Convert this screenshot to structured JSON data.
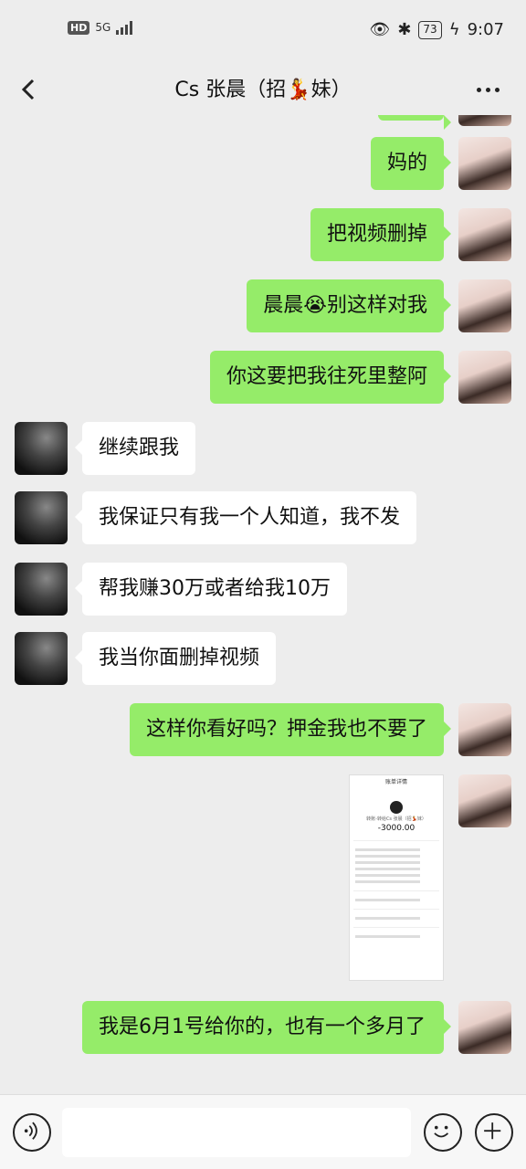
{
  "status": {
    "net": "5G",
    "hd": "HD",
    "battery": "73",
    "time": "9:07"
  },
  "nav": {
    "title": "Cs 张晨（招💃妹）"
  },
  "messages": [
    {
      "from": "me",
      "text": "妈的"
    },
    {
      "from": "me",
      "text": "把视频删掉"
    },
    {
      "from": "me",
      "text": "晨晨😭别这样对我"
    },
    {
      "from": "me",
      "text": "你这要把我往死里整阿"
    },
    {
      "from": "other",
      "text": "继续跟我"
    },
    {
      "from": "other",
      "text": "我保证只有我一个人知道，我不发"
    },
    {
      "from": "other",
      "text": "帮我赚30万或者给我10万"
    },
    {
      "from": "other",
      "text": "我当你面删掉视频"
    },
    {
      "from": "me",
      "text": "这样你看好吗？押金我也不要了"
    },
    {
      "from": "me",
      "text": "我是6月1号给你的，也有一个多月了"
    }
  ],
  "image_message": {
    "header": "账单详情",
    "payee": "转账-转给Cs 张晨（招💃妹）",
    "amount": "-3000.00"
  }
}
